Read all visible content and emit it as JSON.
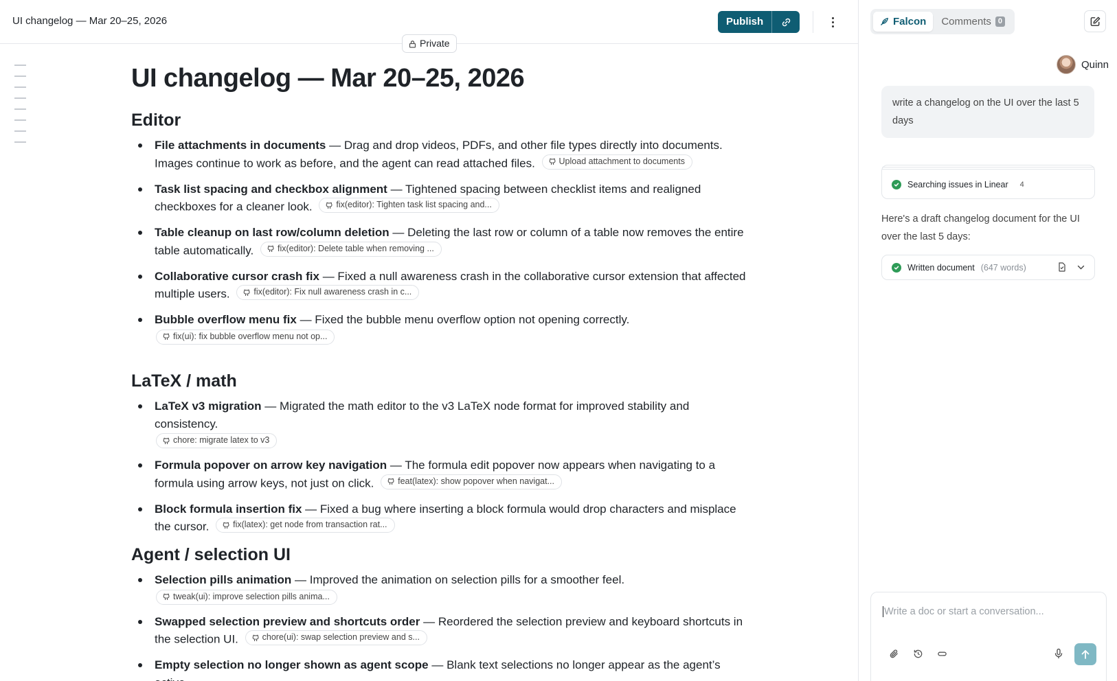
{
  "header": {
    "doc_title": "UI changelog — Mar 20–25, 2026",
    "publish_label": "Publish",
    "visibility": "Private"
  },
  "document": {
    "title": "UI changelog — Mar 20–25, 2026",
    "sections": [
      {
        "heading": "Editor",
        "items": [
          {
            "title": "File attachments in documents",
            "text": " — Drag and drop videos, PDFs, and other file types directly into documents. Images continue to work as before, and the agent can read attached files.",
            "pill": "Upload attachment to documents"
          },
          {
            "title": "Task list spacing and checkbox alignment",
            "text": " — Tightened spacing between checklist items and realigned checkboxes for a cleaner look.",
            "pill": "fix(editor): Tighten task list spacing and..."
          },
          {
            "title": "Table cleanup on last row/column deletion",
            "text": " — Deleting the last row or column of a table now removes the entire table automatically.",
            "pill": "fix(editor): Delete table when removing ..."
          },
          {
            "title": "Collaborative cursor crash fix",
            "text": " — Fixed a null awareness crash in the collaborative cursor extension that affected multiple users.",
            "pill": "fix(editor): Fix null awareness crash in c..."
          },
          {
            "title": "Bubble overflow menu fix",
            "text": " — Fixed the bubble menu overflow option not opening correctly.",
            "pill": "fix(ui): fix bubble overflow menu not op..."
          }
        ]
      },
      {
        "heading": "LaTeX / math",
        "items": [
          {
            "title": "LaTeX v3 migration",
            "text": " — Migrated the math editor to the v3 LaTeX node format for improved stability and consistency.",
            "pill": "chore: migrate latex to v3"
          },
          {
            "title": "Formula popover on arrow key navigation",
            "text": " — The formula edit popover now appears when navigating to a formula using arrow keys, not just on click.",
            "pill": "feat(latex): show popover when navigat..."
          },
          {
            "title": "Block formula insertion fix",
            "text": " — Fixed a bug where inserting a block formula would drop characters and misplace the cursor.",
            "pill": "fix(latex): get node from transaction rat..."
          }
        ]
      },
      {
        "heading": "Agent / selection UI",
        "items": [
          {
            "title": "Selection pills animation",
            "text": " — Improved the animation on selection pills for a smoother feel.",
            "pill": "tweak(ui): improve selection pills anima..."
          },
          {
            "title": "Swapped selection preview and shortcuts order",
            "text": " — Reordered the selection preview and keyboard shortcuts in the selection UI.",
            "pill": "chore(ui): swap selection preview and s..."
          },
          {
            "title": "Empty selection no longer shown as agent scope",
            "text": " — Blank text selections no longer appear as the agent’s active",
            "pill": ""
          }
        ]
      }
    ]
  },
  "chat": {
    "tabs": [
      {
        "label": "Falcon",
        "active": true
      },
      {
        "label": "Comments",
        "count": "0",
        "active": false
      }
    ],
    "user_name": "Quinn",
    "user_message": "write a changelog on the UI over the last 5 days",
    "tool_call": {
      "label": "Searching issues in Linear",
      "count": "4"
    },
    "assistant_message": "Here's a draft changelog document for the UI over the last 5 days:",
    "doc_result": {
      "label": "Written document",
      "meta": "(647 words)"
    },
    "composer_placeholder": "Write a doc or start a conversation..."
  },
  "colors": {
    "accent": "#0f5d73",
    "success": "#2e9b57",
    "send_button": "#7fb8c4"
  },
  "icons": [
    "link-icon",
    "kebab-menu-icon",
    "lock-icon",
    "github-icon",
    "feather-icon",
    "edit-icon",
    "check-icon",
    "file-icon",
    "chevron-down-icon",
    "paperclip-icon",
    "history-icon",
    "loop-icon",
    "mic-icon",
    "arrow-up-icon"
  ]
}
